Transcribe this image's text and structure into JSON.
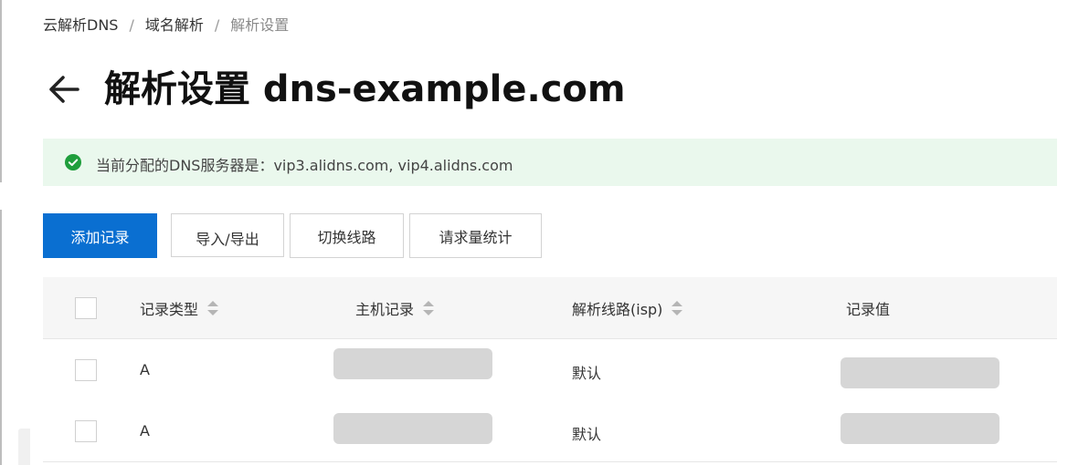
{
  "breadcrumb": {
    "items": [
      "云解析DNS",
      "域名解析",
      "解析设置"
    ],
    "separator": "/"
  },
  "header": {
    "back_icon": "arrow-left-icon",
    "title": "解析设置 dns-example.com"
  },
  "alert": {
    "icon": "check-circle-icon",
    "text": "当前分配的DNS服务器是：vip3.alidns.com, vip4.alidns.com",
    "icon_color": "#1f9e3c",
    "background": "#eaf8ed"
  },
  "toolbar": {
    "add_label": "添加记录",
    "import_export_label": "导入/导出",
    "switch_line_label": "切换线路",
    "stats_label": "请求量统计",
    "primary_color": "#0a6fd1"
  },
  "table": {
    "columns": [
      "记录类型",
      "主机记录",
      "解析线路(isp)",
      "记录值"
    ],
    "rows": [
      {
        "type": "A",
        "line": "默认"
      },
      {
        "type": "A",
        "line": "默认"
      }
    ]
  }
}
